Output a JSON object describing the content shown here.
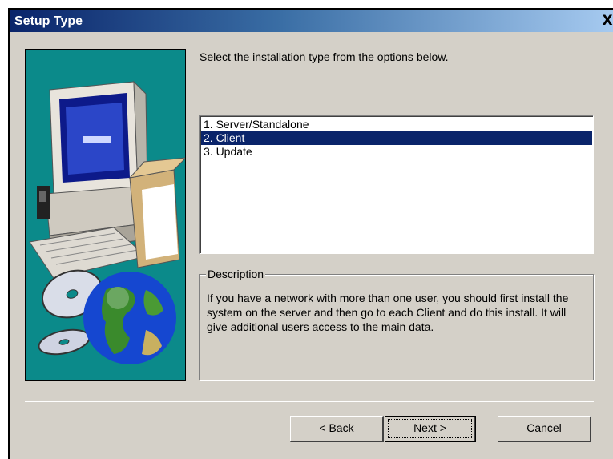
{
  "window": {
    "title": "Setup Type",
    "close_glyph": "X"
  },
  "prompt": "Select the installation type from the options below.",
  "listbox": {
    "items": [
      {
        "label": "1. Server/Standalone",
        "selected": false
      },
      {
        "label": "2. Client",
        "selected": true
      },
      {
        "label": "3. Update",
        "selected": false
      }
    ]
  },
  "description": {
    "legend": "Description",
    "text": "If you have a network with more than one user, you should first install the system on the server and then go to each Client and do this install.  It will give additional users access to the main data."
  },
  "buttons": {
    "back": "< Back",
    "next": "Next >",
    "cancel": "Cancel"
  },
  "colors": {
    "title_gradient_start": "#0a246a",
    "title_gradient_end": "#a6caf0",
    "selection": "#0a246a",
    "face": "#d4d0c8",
    "graphic_background": "#0b8a8a"
  },
  "icons": [
    "computer-illustration",
    "cd-disc-icon",
    "globe-icon"
  ]
}
